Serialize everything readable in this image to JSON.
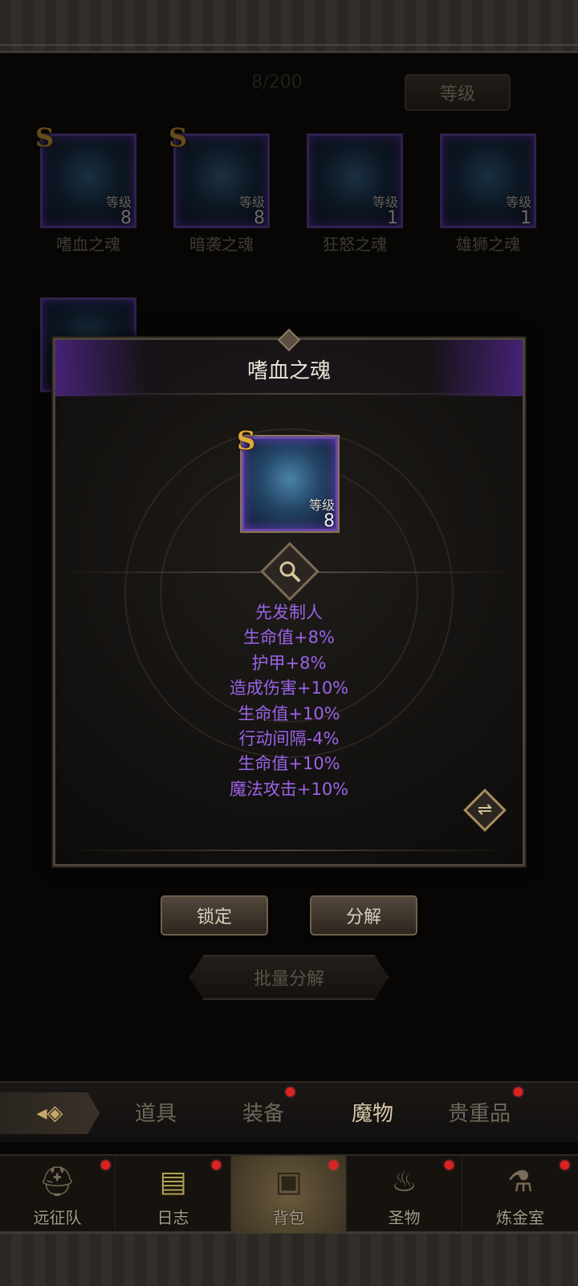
{
  "header": {
    "capacity": "8/200",
    "sort_label": "等级"
  },
  "grid": [
    {
      "name": "嗜血之魂",
      "rank": "S",
      "level_label": "等级",
      "level": "8"
    },
    {
      "name": "暗袭之魂",
      "rank": "S",
      "level_label": "等级",
      "level": "8"
    },
    {
      "name": "狂怒之魂",
      "rank": "",
      "level_label": "等级",
      "level": "1"
    },
    {
      "name": "雄狮之魂",
      "rank": "",
      "level_label": "等级",
      "level": "1"
    }
  ],
  "modal": {
    "title": "嗜血之魂",
    "item": {
      "rank": "S",
      "level_label": "等级",
      "level": "8"
    },
    "stats": [
      "先发制人",
      "生命值+8%",
      "护甲+8%",
      "造成伤害+10%",
      "生命值+10%",
      "行动间隔-4%",
      "生命值+10%",
      "魔法攻击+10%"
    ],
    "lock_label": "锁定",
    "decompose_label": "分解"
  },
  "bulk_decompose_label": "批量分解",
  "tabs": [
    {
      "label": "道具",
      "dot": false
    },
    {
      "label": "装备",
      "dot": true
    },
    {
      "label": "魔物",
      "dot": false,
      "active": true
    },
    {
      "label": "贵重品",
      "dot": true
    }
  ],
  "nav": [
    {
      "label": "远征队",
      "icon": "viking-helmet-icon"
    },
    {
      "label": "日志",
      "icon": "journal-icon"
    },
    {
      "label": "背包",
      "icon": "backpack-icon",
      "active": true
    },
    {
      "label": "圣物",
      "icon": "torch-icon"
    },
    {
      "label": "炼金室",
      "icon": "alchemy-icon"
    }
  ],
  "colors": {
    "stat_text": "#9b63e6",
    "rank_gold": "#e0a93a",
    "frame_purple": "#6a4aa8",
    "notification": "#dd2222"
  }
}
